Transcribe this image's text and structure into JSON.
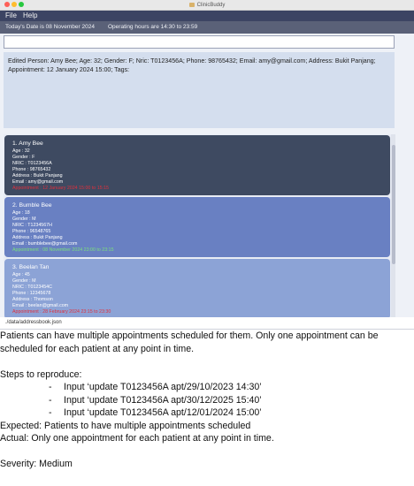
{
  "window": {
    "title": "ClinicBuddy"
  },
  "menu": {
    "items": [
      "File",
      "Help"
    ]
  },
  "status": {
    "date_text": "Today's Date is 08 November 2024",
    "hours_text": "Operating hours are 14:30 to 23:59"
  },
  "command": {
    "value": ""
  },
  "result": {
    "text": "Edited Person: Amy Bee; Age: 32; Gender: F; Nric: T0123456A; Phone: 98765432; Email: amy@gmail.com; Address: Bukit Panjang; Appointment: 12 January 2024 15:00; Tags:"
  },
  "patients": [
    {
      "name": "1. Amy Bee",
      "age": "Age : 32",
      "gender": "Gender : F",
      "nric": "NRIC : T0123456A",
      "phone": "Phone : 98765432",
      "address": "Address : Bukit Panjang",
      "email": "Email : amy@gmail.com",
      "appointment": "Appointment : 12 January 2024 15:00 to 15:15"
    },
    {
      "name": "2. Bumble Bee",
      "age": "Age : 18",
      "gender": "Gender : M",
      "nric": "NRIC : T1234567H",
      "phone": "Phone : 96548765",
      "address": "Address : Bukit Panjang",
      "email": "Email : bumblebee@gmail.com",
      "appointment": "Appointment : 08 November 2024 23:00 to 23:15"
    },
    {
      "name": "3. Beelan Tan",
      "age": "Age : 45",
      "gender": "Gender : M",
      "nric": "NRIC : T0123454C",
      "phone": "Phone : 12345678",
      "address": "Address : Thomson",
      "email": "Email : beelan@gmail.com",
      "appointment": "Appointment : 28 February 2024 23:15 to 23:30"
    }
  ],
  "footer": {
    "path": "./data/addressbook.json"
  },
  "report": {
    "description": "Patients can have multiple appointments scheduled for them. Only one appointment can be scheduled for each patient at any point in time.",
    "steps_heading": "Steps to reproduce:",
    "steps": [
      "Input ‘update T0123456A apt/29/10/2023 14:30’",
      "Input ‘update T0123456A apt/30/12/2025 15:40’",
      "Input ‘update T0123456A apt/12/01/2024 15:00’"
    ],
    "expected": "Expected: Patients to have multiple appointments scheduled",
    "actual": "Actual: Only one appointment for each patient at any point in time.",
    "severity": "Severity: Medium"
  },
  "colors": {
    "menubar": "#3c4463",
    "statusbar": "#5a6178",
    "card_selected": "#3e4a61",
    "card_2": "#6980c2",
    "card_3": "#8ca3d6",
    "appointment_past": "#e0303d",
    "appointment_today": "#7be07b"
  }
}
